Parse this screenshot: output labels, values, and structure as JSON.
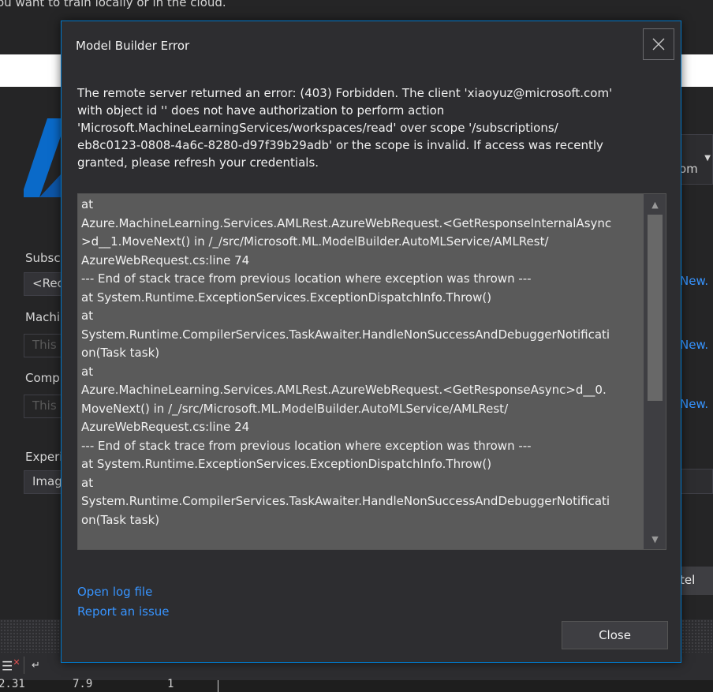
{
  "background": {
    "top_text": "ou want to train locally or in the cloud.",
    "labels": {
      "subscription": "Subsc",
      "machine": "Machi",
      "compute": "Comp",
      "experiment": "Experi"
    },
    "fields": {
      "subscription_value": "<Rec",
      "machine_placeholder": "This",
      "compute_placeholder": "This",
      "experiment_value": "Imag"
    },
    "account_combo": "om",
    "new_links": [
      "New.",
      "New.",
      "New."
    ],
    "right_button_label": "tel",
    "data_row": [
      "2.31",
      "7.9",
      "1"
    ]
  },
  "dialog": {
    "title": "Model Builder Error",
    "message_lines": [
      "The remote server returned an error: (403) Forbidden. The client 'xiaoyuz@microsoft.com'",
      "with object id '' does not have authorization to perform action",
      "'Microsoft.MachineLearningServices/workspaces/read' over scope '/subscriptions/",
      "eb8c0123-0808-4a6c-8280-d97f39b29adb' or the scope is invalid. If access was recently",
      "granted, please refresh your credentials."
    ],
    "stack_trace_lines": [
      "   at",
      "Azure.MachineLearning.Services.AMLRest.AzureWebRequest.<GetResponseInternalAsync",
      ">d__1.MoveNext() in /_/src/Microsoft.ML.ModelBuilder.AutoMLService/AMLRest/",
      "AzureWebRequest.cs:line 74",
      "--- End of stack trace from previous location where exception was thrown ---",
      "   at System.Runtime.ExceptionServices.ExceptionDispatchInfo.Throw()",
      "   at",
      "System.Runtime.CompilerServices.TaskAwaiter.HandleNonSuccessAndDebuggerNotificati",
      "on(Task task)",
      "   at",
      "Azure.MachineLearning.Services.AMLRest.AzureWebRequest.<GetResponseAsync>d__0.",
      "MoveNext() in /_/src/Microsoft.ML.ModelBuilder.AutoMLService/AMLRest/",
      "AzureWebRequest.cs:line 24",
      "--- End of stack trace from previous location where exception was thrown ---",
      "   at System.Runtime.ExceptionServices.ExceptionDispatchInfo.Throw()",
      "   at",
      "System.Runtime.CompilerServices.TaskAwaiter.HandleNonSuccessAndDebuggerNotificati",
      "on(Task task)"
    ],
    "open_log_label": "Open log file",
    "report_issue_label": "Report an issue",
    "close_button_label": "Close"
  },
  "icons": {
    "close": "close-icon",
    "scroll_up": "chevron-up-icon",
    "scroll_down": "chevron-down-icon"
  },
  "colors": {
    "accent_border": "#007acc",
    "link": "#3794ff",
    "dialog_bg": "#2d2d30",
    "trace_bg": "#5a5a5a"
  }
}
